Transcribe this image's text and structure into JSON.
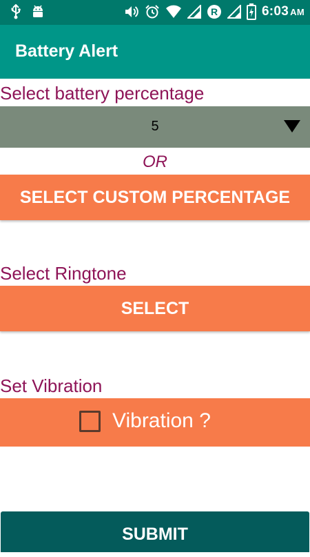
{
  "status_bar": {
    "time": "6:03",
    "ampm": "AM",
    "icons_left": [
      "usb-icon",
      "android-debug-icon"
    ],
    "icons_right": [
      "volume-icon",
      "alarm-icon",
      "wifi-icon",
      "signal-icon",
      "roaming-r-icon",
      "signal-2-icon",
      "battery-charging-icon"
    ]
  },
  "app_bar": {
    "title": "Battery Alert"
  },
  "battery_section": {
    "label": "Select battery percentage",
    "spinner_value": "5",
    "or_label": "OR",
    "custom_button": "SELECT CUSTOM PERCENTAGE"
  },
  "ringtone_section": {
    "label": "Select Ringtone",
    "select_button": "SELECT"
  },
  "vibration_section": {
    "label": "Set Vibration",
    "checkbox_label": "Vibration ?",
    "checked": false
  },
  "submit_button": "SUBMIT",
  "colors": {
    "status_bar": "#00796b",
    "app_bar": "#009688",
    "label_text": "#8e1457",
    "spinner_bg": "#7a8a7b",
    "orange_button": "#f77b4a",
    "submit_bg": "#045b5b"
  }
}
